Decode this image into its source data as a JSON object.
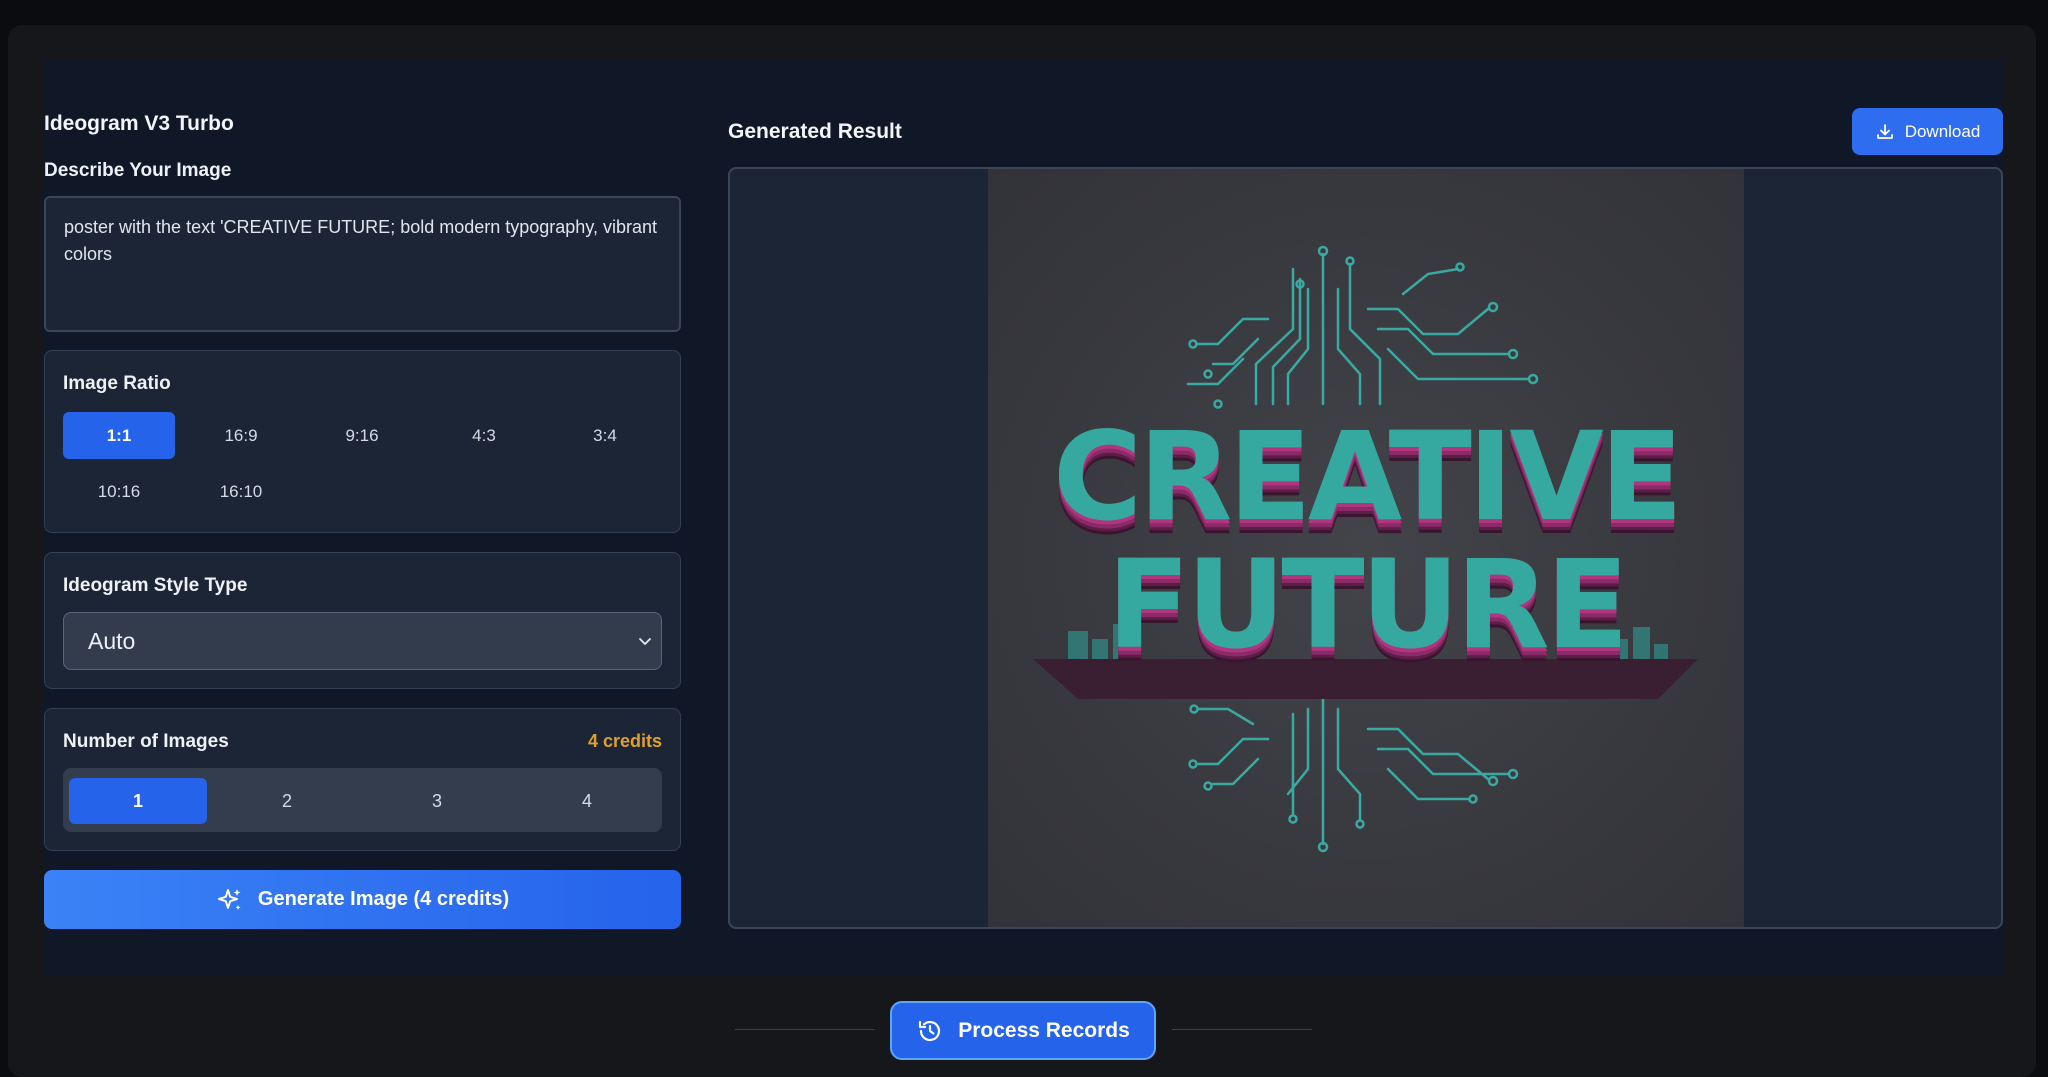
{
  "app": {
    "title": "Ideogram V3 Turbo"
  },
  "prompt": {
    "label": "Describe Your Image",
    "value": "poster with the text 'CREATIVE FUTURE; bold modern typography, vibrant colors"
  },
  "ratio": {
    "label": "Image Ratio",
    "options": [
      "1:1",
      "16:9",
      "9:16",
      "4:3",
      "3:4",
      "10:16",
      "16:10"
    ],
    "selected": "1:1"
  },
  "style": {
    "label": "Ideogram Style Type",
    "selected": "Auto"
  },
  "count": {
    "label": "Number of Images",
    "credits": "4 credits",
    "options": [
      "1",
      "2",
      "3",
      "4"
    ],
    "selected": "1"
  },
  "generate": {
    "label": "Generate Image (4 credits)",
    "icon": "sparkle-icon"
  },
  "result": {
    "title": "Generated Result",
    "download_label": "Download",
    "image_text_line1": "CREATIVE",
    "image_text_line2": "FUTURE"
  },
  "footer": {
    "process_label": "Process Records",
    "icon": "history-icon"
  },
  "colors": {
    "accent": "#2563eb",
    "credits": "#e0a12b",
    "panel": "#101828",
    "card": "#1b2535"
  }
}
